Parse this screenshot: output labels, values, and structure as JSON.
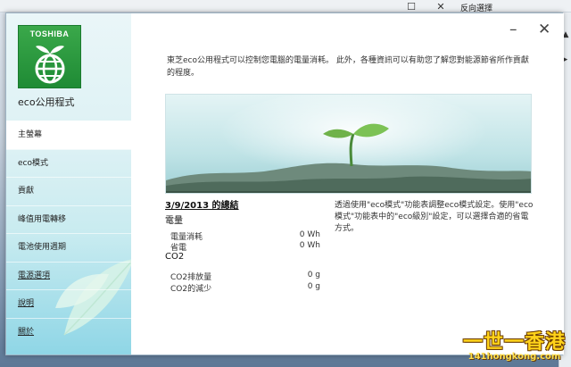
{
  "desktop": {
    "menu_label": "反向選擇",
    "watermark_main": "一世一香港",
    "watermark_url": "141hongkong.com"
  },
  "logo": {
    "brand": "TOSHIBA"
  },
  "app": {
    "name": "eco公用程式"
  },
  "nav": {
    "items": [
      {
        "label": "主螢幕"
      },
      {
        "label": "eco模式"
      },
      {
        "label": "貢獻"
      },
      {
        "label": "峰值用電轉移"
      },
      {
        "label": "電池使用週期"
      },
      {
        "label": "電源選項"
      },
      {
        "label": "說明"
      },
      {
        "label": "關於"
      }
    ]
  },
  "window_controls": {
    "minimize": "–",
    "close": "✕"
  },
  "main": {
    "intro": "東芝eco公用程式可以控制您電腦的電量消耗。 此外，各種資訊可以有助您了解您對能源節省所作貢獻的程度。",
    "summary_title": "3/9/2013 的總結",
    "electricity": {
      "heading": "電量",
      "rows": [
        {
          "label": "電量消耗",
          "value": "0 Wh"
        },
        {
          "label": "省電",
          "value": "0 Wh"
        }
      ]
    },
    "co2": {
      "heading": "CO2",
      "rows": [
        {
          "label": "CO2排放量",
          "value": "0 g"
        },
        {
          "label": "CO2的減少",
          "value": "0 g"
        }
      ]
    },
    "note": "透過使用\"eco模式\"功能表調整eco模式設定。使用\"eco模式\"功能表中的\"eco級別\"設定，可以選擇合適的省電方式。"
  }
}
